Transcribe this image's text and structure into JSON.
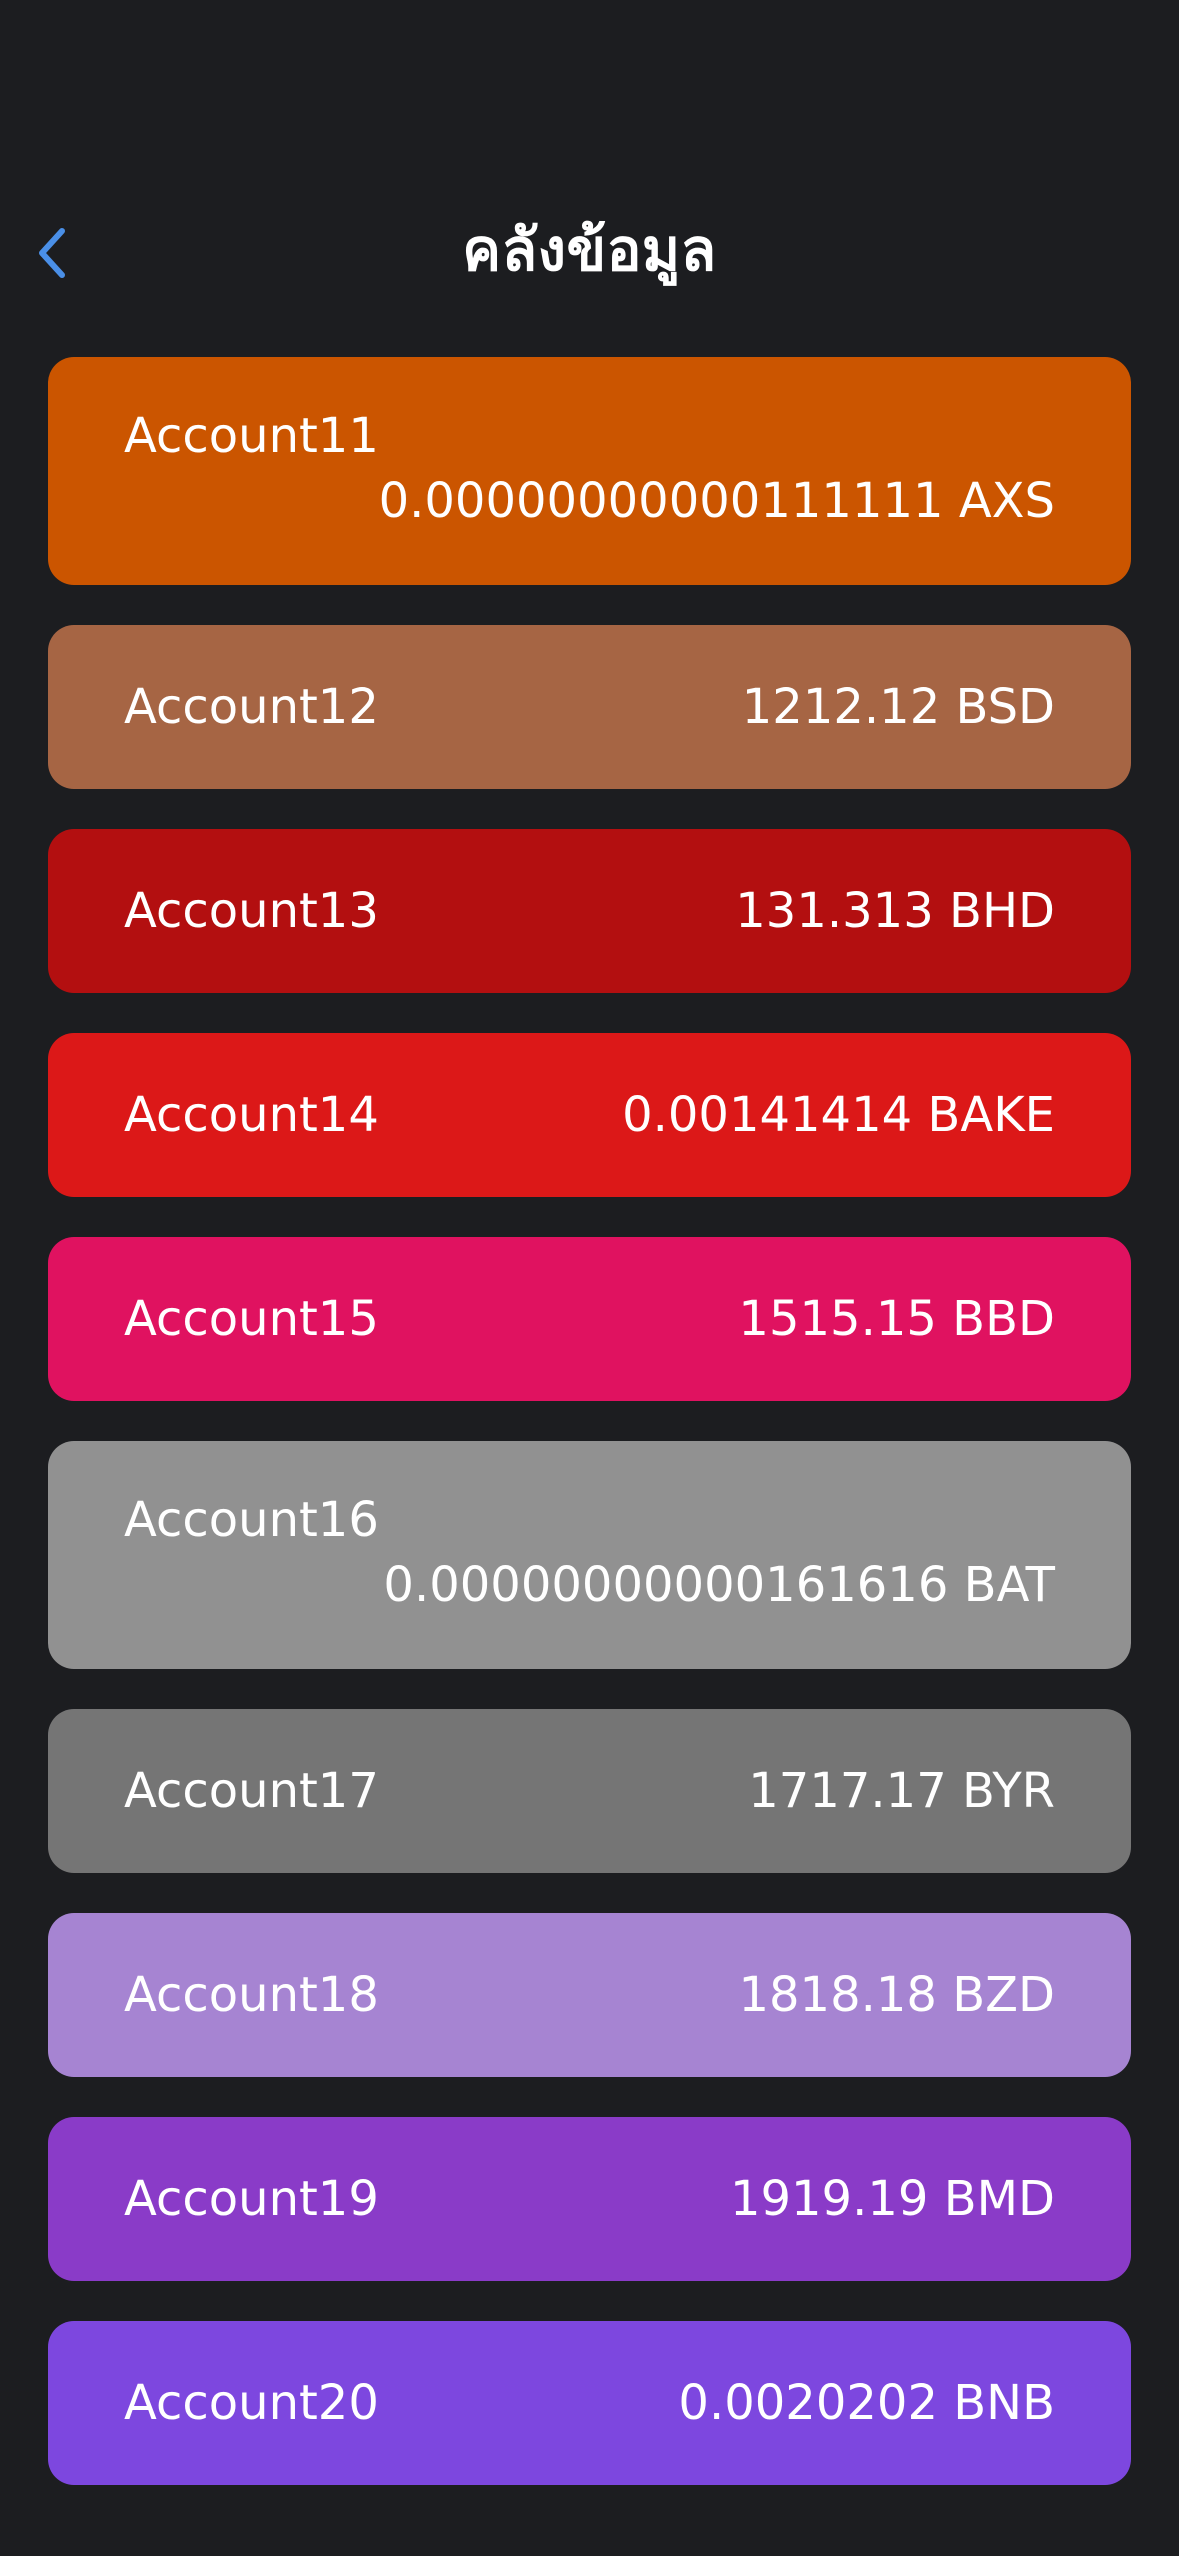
{
  "header": {
    "back_icon": "chevron-left-icon",
    "title": "คลังข้อมูล",
    "accent": "#4a8fe7"
  },
  "accounts": [
    {
      "name": "Account11",
      "amount": "0.00000000000111111 AXS",
      "color": "#cb5500"
    },
    {
      "name": "Account12",
      "amount": "1212.12 BSD",
      "color": "#a66544"
    },
    {
      "name": "Account13",
      "amount": "131.313 BHD",
      "color": "#b30f10"
    },
    {
      "name": "Account14",
      "amount": "0.00141414 BAKE",
      "color": "#dc1818"
    },
    {
      "name": "Account15",
      "amount": "1515.15 BBD",
      "color": "#e01260"
    },
    {
      "name": "Account16",
      "amount": "0.00000000000161616 BAT",
      "color": "#919191"
    },
    {
      "name": "Account17",
      "amount": "1717.17 BYR",
      "color": "#757575"
    },
    {
      "name": "Account18",
      "amount": "1818.18 BZD",
      "color": "#a684d2"
    },
    {
      "name": "Account19",
      "amount": "1919.19 BMD",
      "color": "#8a3bc8"
    },
    {
      "name": "Account20",
      "amount": "0.0020202 BNB",
      "color": "#7d47df"
    }
  ]
}
